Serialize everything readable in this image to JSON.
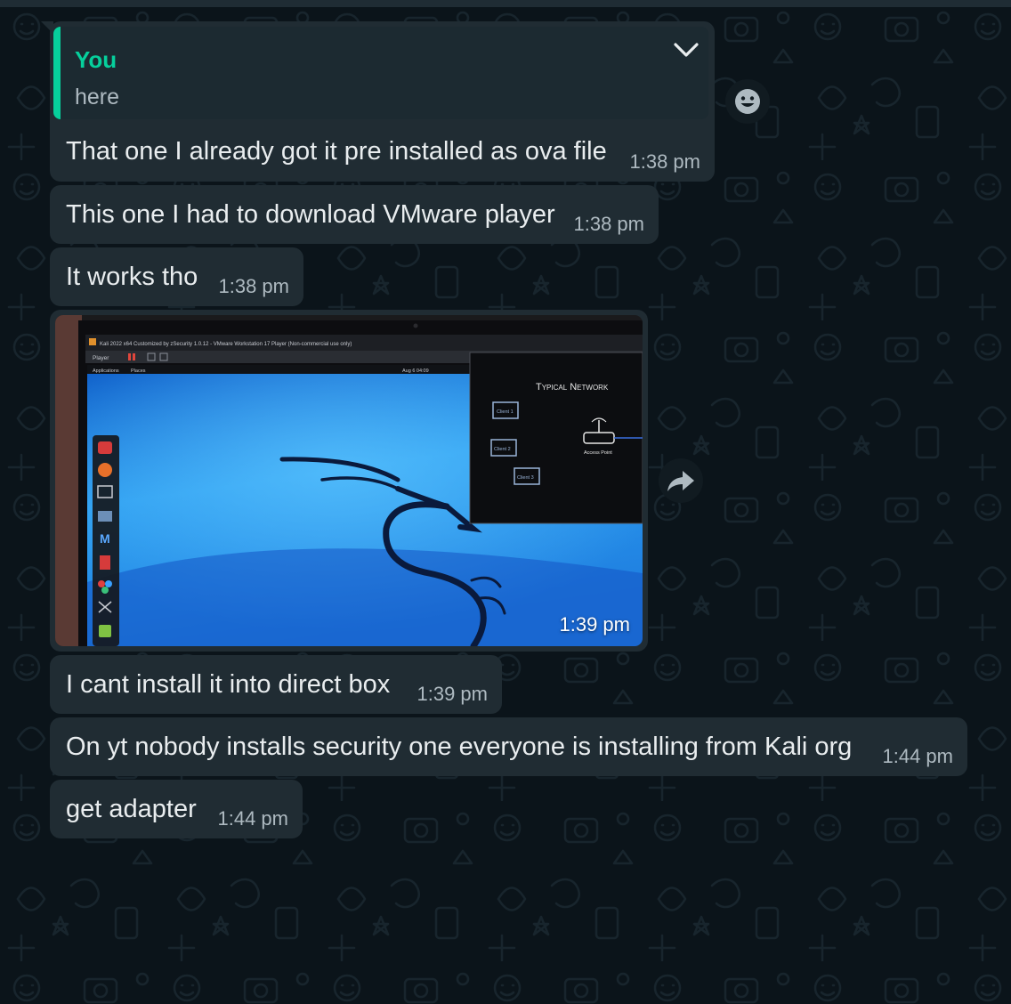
{
  "reply": {
    "quoted_sender": "You",
    "quoted_text": "here",
    "text": "That one I already got it pre installed as ova file",
    "time": "1:38 pm"
  },
  "messages": [
    {
      "text": "This one I had to download VMware player",
      "time": "1:38 pm"
    },
    {
      "text": "It works tho",
      "time": "1:38 pm"
    },
    {
      "text": "I cant install it into direct box",
      "time": "1:39 pm"
    },
    {
      "text": "On yt nobody installs security one everyone is installing from Kali org",
      "time": "1:44 pm"
    },
    {
      "text": "get adapter",
      "time": "1:44 pm"
    }
  ],
  "photo_message": {
    "time": "1:39 pm",
    "screen": {
      "window_title": "Kali 2022 x64 Customized by zSecurity 1.0.12 - VMware Workstation 17 Player (Non-commercial use only)",
      "menu_player": "Player",
      "panel_apps": "Applications",
      "panel_places": "Places",
      "panel_clock": "Aug 6  04:09",
      "slide_title": "Typical Network",
      "client_1": "Client 1",
      "client_2": "Client 2",
      "client_3": "Client 3",
      "access_point": "Access Point"
    }
  },
  "colors": {
    "background": "#0b141a",
    "bubble": "#202c33",
    "accent": "#06cf9c",
    "text": "#e9edef",
    "meta": "#aebac1"
  },
  "icons": {
    "dropdown": "chevron-down-icon",
    "react": "emoji-icon",
    "forward": "forward-icon"
  }
}
